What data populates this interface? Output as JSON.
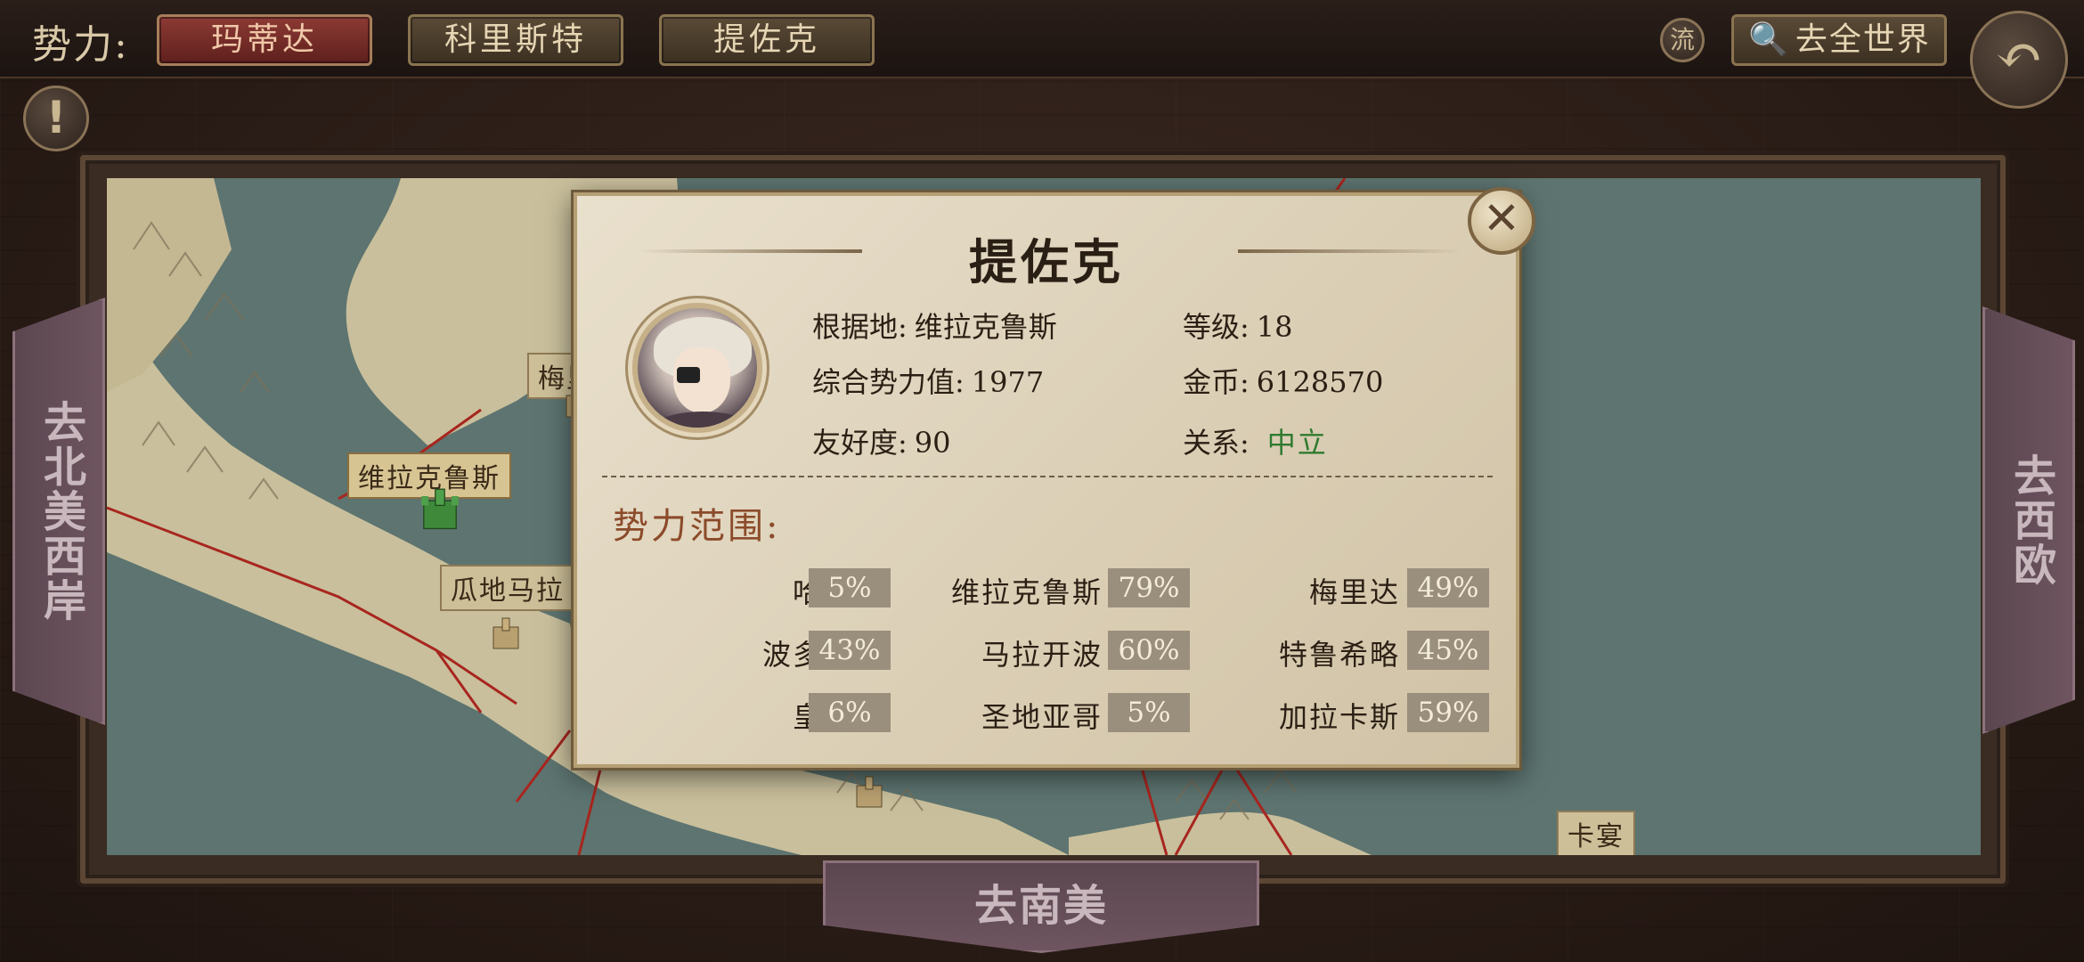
{
  "topbar": {
    "faction_label": "势力:",
    "tabs": [
      {
        "label": "玛蒂达",
        "active": true
      },
      {
        "label": "科里斯特",
        "active": false
      },
      {
        "label": "提佐克",
        "active": false
      }
    ],
    "flow_label": "流",
    "world_search_label": "去全世界",
    "icons": {
      "search": "search-icon",
      "back": "back-arrow-icon",
      "alert": "alert-icon"
    }
  },
  "navigation": {
    "left": "去北美西岸",
    "right": "去西欧",
    "bottom": "去南美"
  },
  "map": {
    "labels": [
      "维拉克鲁斯",
      "梅里",
      "瓜地马拉",
      "卡宴"
    ],
    "colors": {
      "sea": "#5d7470",
      "land": "#c9bf9c",
      "border_lines": "#a8261f"
    }
  },
  "modal": {
    "title": "提佐克",
    "close_icon": "close-icon",
    "base": {
      "label": "根据地:",
      "value": "维拉克鲁斯"
    },
    "level": {
      "label": "等级:",
      "value": "18"
    },
    "power": {
      "label": "综合势力值:",
      "value": "1977"
    },
    "gold": {
      "label": "金币:",
      "value": "6128570"
    },
    "friendship": {
      "label": "友好度:",
      "value": "90"
    },
    "relation": {
      "label": "关系:",
      "value": "中立",
      "color": "#2f7a30"
    },
    "range_title": "势力范围:",
    "ranges": [
      {
        "name": "哈瓦那",
        "pct": "5%"
      },
      {
        "name": "维拉克鲁斯",
        "pct": "79%"
      },
      {
        "name": "梅里达",
        "pct": "49%"
      },
      {
        "name": "波多贝罗",
        "pct": "43%"
      },
      {
        "name": "马拉开波",
        "pct": "60%"
      },
      {
        "name": "特鲁希略",
        "pct": "45%"
      },
      {
        "name": "皇家港",
        "pct": "6%"
      },
      {
        "name": "圣地亚哥",
        "pct": "5%"
      },
      {
        "name": "加拉卡斯",
        "pct": "59%"
      }
    ]
  }
}
